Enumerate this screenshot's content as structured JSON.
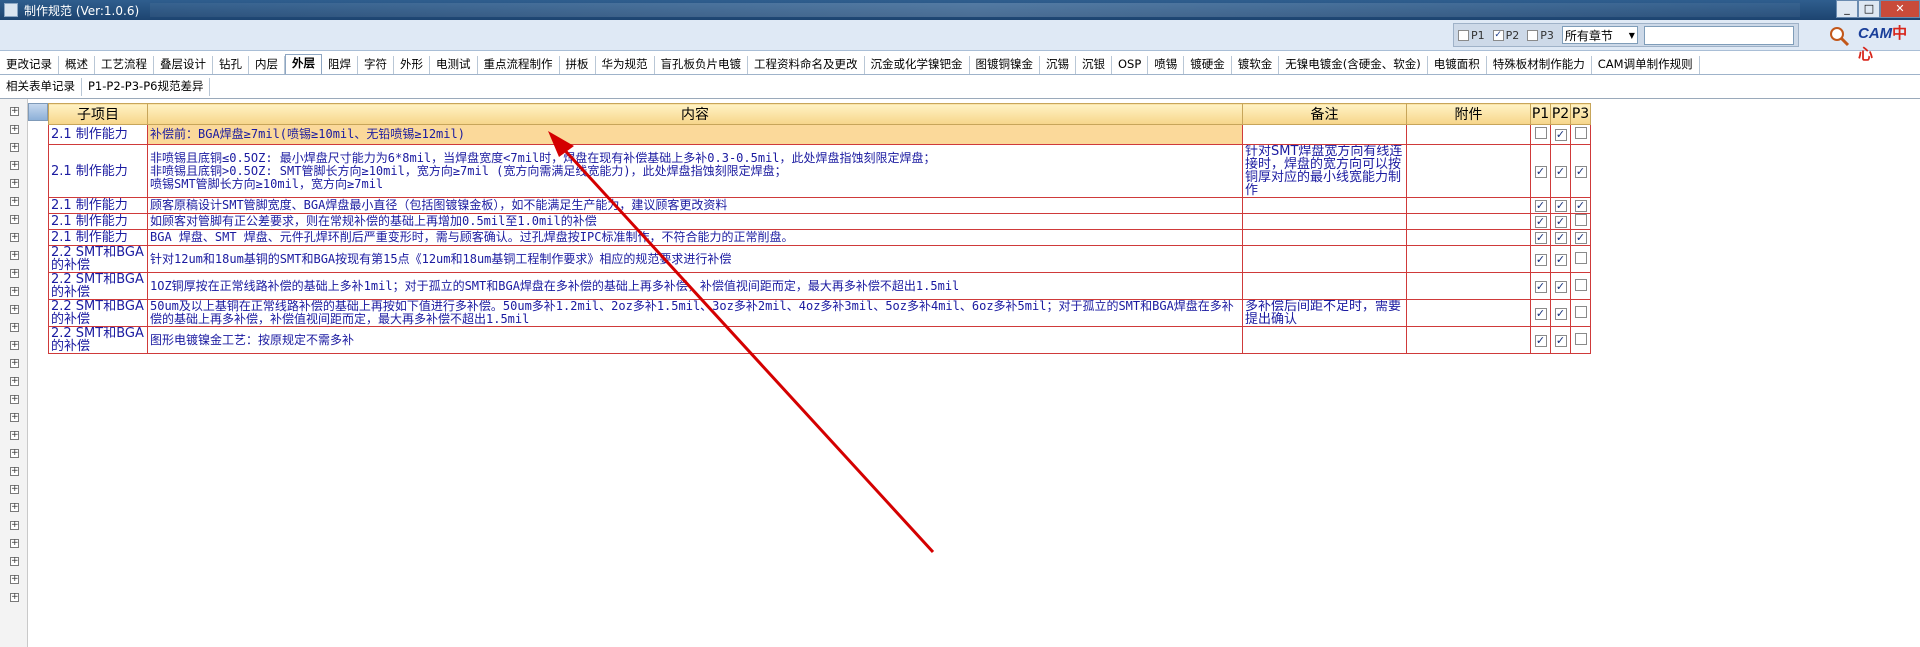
{
  "window": {
    "title": "制作规范 (Ver:1.0.6)",
    "controls": [
      "_",
      "□",
      "✕"
    ]
  },
  "filter": {
    "p1_label": "P1",
    "p1_checked": false,
    "p2_label": "P2",
    "p2_checked": true,
    "p3_label": "P3",
    "p3_checked": false,
    "chapter_value": "所有章节",
    "search_value": ""
  },
  "logo": {
    "prefix": "CAM",
    "suffix": "中心"
  },
  "tabs_row1": [
    "更改记录",
    "概述",
    "工艺流程",
    "叠层设计",
    "钻孔",
    "内层",
    "外层",
    "阻焊",
    "字符",
    "外形",
    "电测试",
    "重点流程制作",
    "拼板",
    "华为规范",
    "盲孔板负片电镀",
    "工程资料命名及更改",
    "沉金或化学镍钯金",
    "图镀铜镍金",
    "沉锡",
    "沉银",
    "OSP",
    "喷锡",
    "镀硬金",
    "镀软金",
    "无镍电镀金(含硬金、软金)",
    "电镀面积",
    "特殊板材制作能力",
    "CAM调单制作规则"
  ],
  "active_tab": "外层",
  "tabs_row2": [
    "相关表单记录",
    "P1-P2-P3-P6规范差异"
  ],
  "table": {
    "headers": [
      "子项目",
      "内容",
      "备注",
      "附件",
      "P1",
      "P2",
      "P3"
    ],
    "rows": [
      {
        "sub": "2.1 制作能力",
        "content": "补偿前：BGA焊盘≥7mil(喷锡≥10mil、无铅喷锡≥12mil)",
        "note": "",
        "p1": false,
        "p2": true,
        "p3": false
      },
      {
        "sub": "2.1 制作能力",
        "content": "非喷锡且底铜≤0.5OZ: 最小焊盘尺寸能力为6*8mil，当焊盘宽度<7mil时，焊盘在现有补偿基础上多补0.3-0.5mil，此处焊盘指蚀刻限定焊盘；\n非喷锡且底铜>0.5OZ: SMT管脚长方向≥10mil，宽方向≥7mil (宽方向需满足线宽能力)，此处焊盘指蚀刻限定焊盘；\n喷锡SMT管脚长方向≥10mil，宽方向≥7mil",
        "note": "针对SMT焊盘宽方向有线连接时，焊盘的宽方向可以按铜厚对应的最小线宽能力制作",
        "p1": true,
        "p2": true,
        "p3": true
      },
      {
        "sub": "2.1 制作能力",
        "content": "顾客原稿设计SMT管脚宽度、BGA焊盘最小直径（包括图镀镍金板），如不能满足生产能力，建议顾客更改资料",
        "note": "",
        "p1": true,
        "p2": true,
        "p3": true
      },
      {
        "sub": "2.1 制作能力",
        "content": "如顾客对管脚有正公差要求，则在常规补偿的基础上再增加0.5mil至1.0mil的补偿",
        "note": "",
        "p1": true,
        "p2": true,
        "p3": false
      },
      {
        "sub": "2.1 制作能力",
        "content": "BGA 焊盘、SMT 焊盘、元件孔焊环削后严重变形时，需与顾客确认。过孔焊盘按IPC标准制作，不符合能力的正常削盘。",
        "note": "",
        "p1": true,
        "p2": true,
        "p3": true
      },
      {
        "sub": "2.2 SMT和BGA的补偿",
        "content": "针对12um和18um基铜的SMT和BGA按现有第15点《12um和18um基铜工程制作要求》相应的规范要求进行补偿",
        "note": "",
        "p1": true,
        "p2": true,
        "p3": false
      },
      {
        "sub": "2.2 SMT和BGA的补偿",
        "content": "1OZ铜厚按在正常线路补偿的基础上多补1mil；对于孤立的SMT和BGA焊盘在多补偿的基础上再多补偿，补偿值视间距而定，最大再多补偿不超出1.5mil",
        "note": "",
        "p1": true,
        "p2": true,
        "p3": false
      },
      {
        "sub": "2.2 SMT和BGA的补偿",
        "content": "50um及以上基铜在正常线路补偿的基础上再按如下值进行多补偿。50um多补1.2mil、2oz多补1.5mil、3oz多补2mil、4oz多补3mil、5oz多补4mil、6oz多补5mil；对于孤立的SMT和BGA焊盘在多补偿的基础上再多补偿，补偿值视间距而定，最大再多补偿不超出1.5mil",
        "note": "多补偿后间距不足时，需要提出确认",
        "p1": true,
        "p2": true,
        "p3": false
      },
      {
        "sub": "2.2 SMT和BGA的补偿",
        "content": "图形电镀镍金工艺：按原规定不需多补",
        "note": "",
        "p1": true,
        "p2": true,
        "p3": false
      }
    ]
  },
  "colors": {
    "accent": "#1a1aa0",
    "grid_border": "#cf3a3a",
    "header": "#f6d58a",
    "annotation_arrow": "#d40000"
  }
}
